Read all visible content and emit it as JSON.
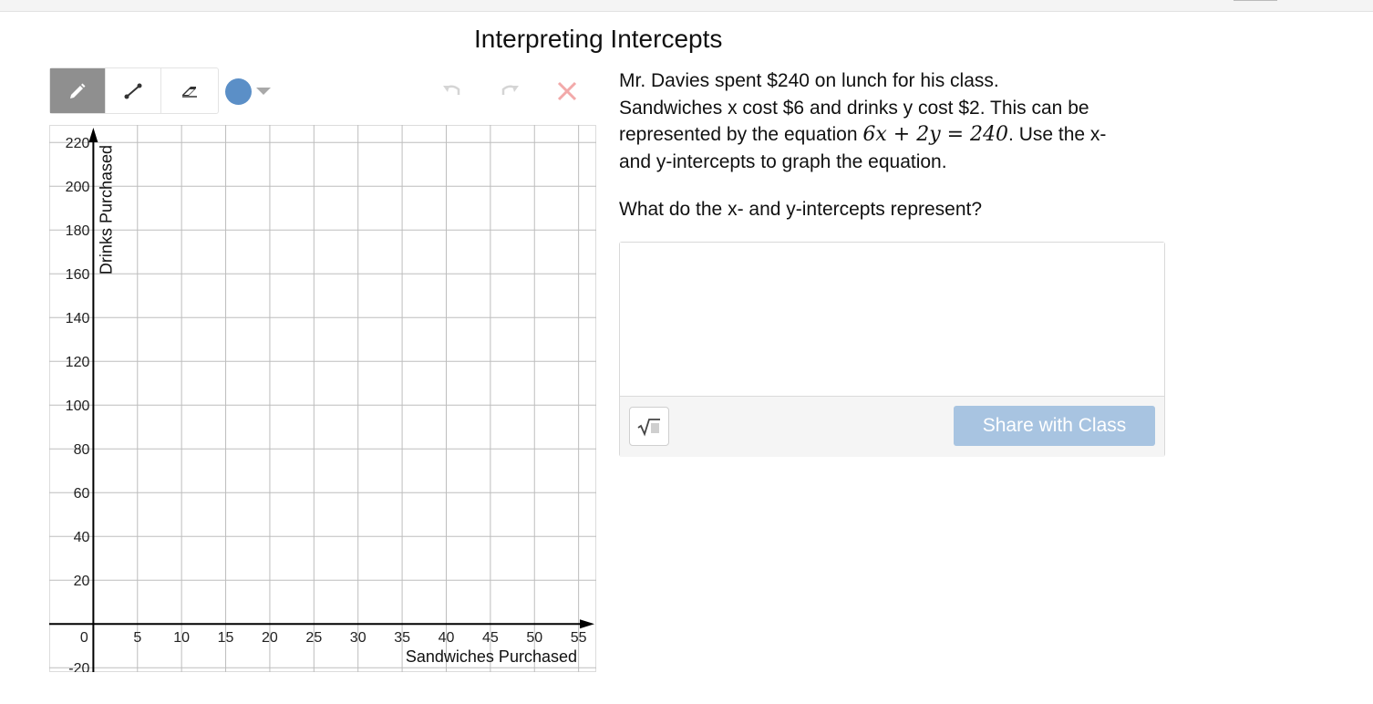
{
  "title": "Interpreting Intercepts",
  "toolbar": {
    "tools": [
      {
        "name": "pencil-tool",
        "icon": "pencil-icon",
        "active": true
      },
      {
        "name": "line-tool",
        "icon": "line-segment-icon",
        "active": false
      },
      {
        "name": "eraser-tool",
        "icon": "eraser-icon",
        "active": false
      }
    ],
    "color": "#5b8fc7",
    "undo_icon": "undo-icon",
    "redo_icon": "redo-icon",
    "clear_icon": "close-icon"
  },
  "prompt": {
    "line1": "Mr. Davies spent $240 on lunch for his class.",
    "line2": "Sandwiches x cost $6 and drinks y cost $2. This can be",
    "line3_pre": "represented by the equation",
    "equation": "6x + 2y = 240",
    "line3_post": ". Use the x-",
    "line4": "and y-intercepts to graph the equation."
  },
  "question": "What do the x- and y-intercepts represent?",
  "answer": {
    "value": "",
    "math_button_icon": "square-root-icon",
    "share_label": "Share with Class"
  },
  "chart_data": {
    "type": "scatter",
    "xlabel": "Sandwiches Purchased",
    "ylabel": "Drinks Purchased",
    "xlim": [
      -5,
      57
    ],
    "ylim": [
      -22,
      228
    ],
    "x_ticks": [
      "0",
      "5",
      "10",
      "15",
      "20",
      "25",
      "30",
      "35",
      "40",
      "45",
      "50",
      "55"
    ],
    "y_ticks": [
      "-20",
      "20",
      "40",
      "60",
      "80",
      "100",
      "120",
      "140",
      "160",
      "180",
      "200",
      "220"
    ],
    "grid": true,
    "points": []
  }
}
